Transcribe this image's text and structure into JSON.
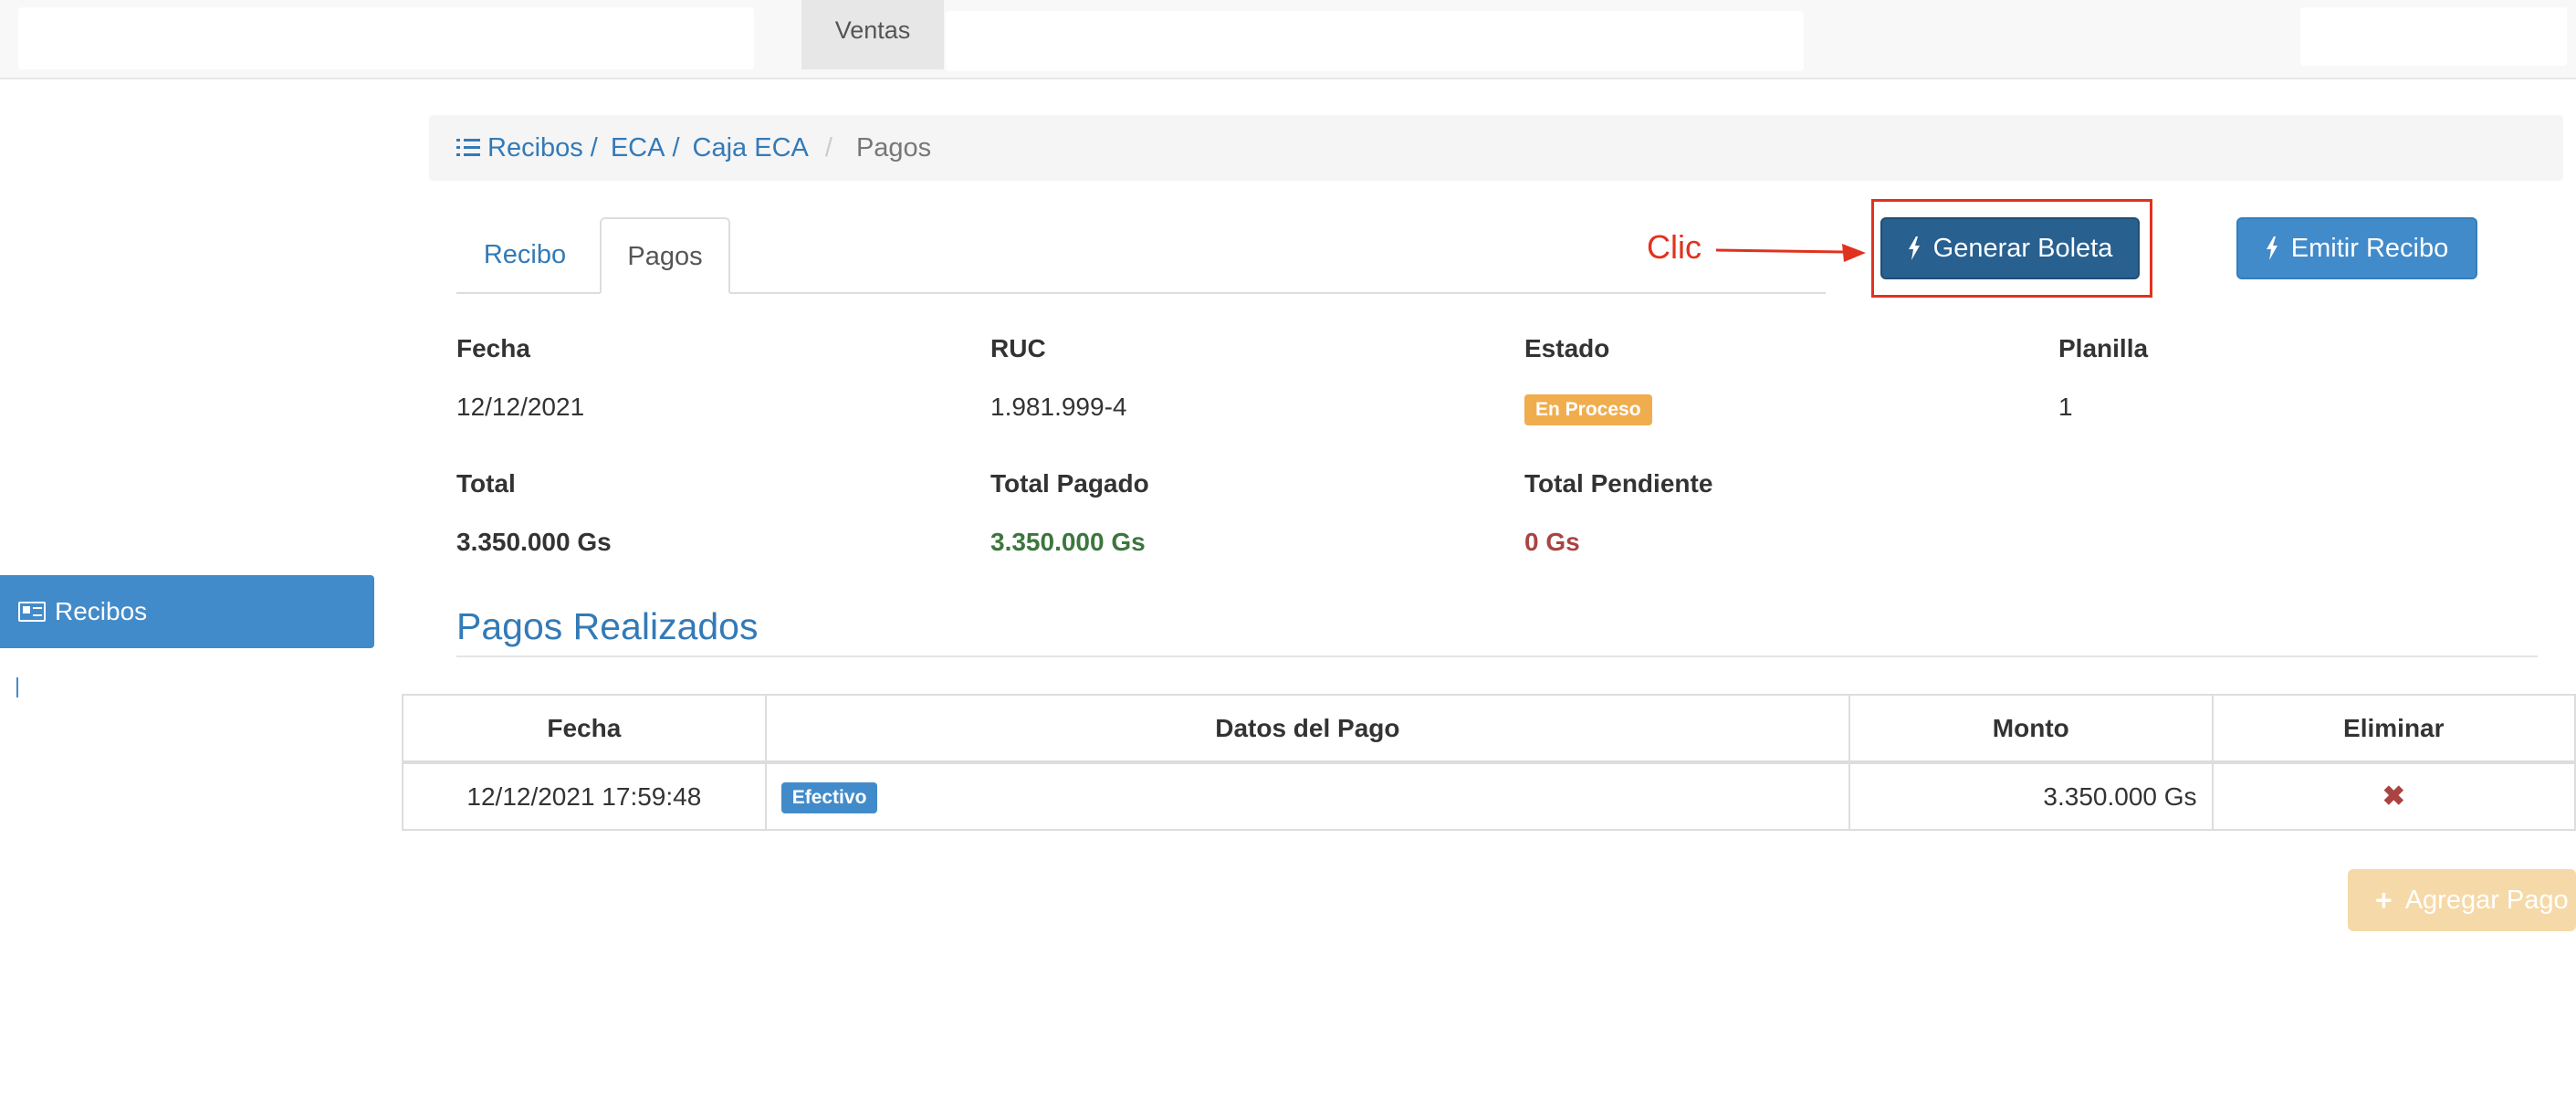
{
  "topbar": {
    "nav_item": "Ventas"
  },
  "sidebar": {
    "items": [
      {
        "label": "Recibos",
        "icon": "newspaper-icon"
      }
    ]
  },
  "breadcrumb": {
    "icon": "list-icon",
    "items": [
      "Recibos",
      "ECA",
      "Caja ECA"
    ],
    "separator": "/",
    "active": "Pagos"
  },
  "tabs": [
    {
      "label": "Recibo"
    },
    {
      "label": "Pagos",
      "active": true
    }
  ],
  "actions": {
    "generate_label": "Generar Boleta",
    "emit_label": "Emitir Recibo",
    "add_payment_label": "Agregar Pago",
    "annotation_label": "Clic",
    "icon": "bolt-icon"
  },
  "info": {
    "fecha_label": "Fecha",
    "fecha": "12/12/2021",
    "ruc_label": "RUC",
    "ruc": "1.981.999-4",
    "estado_label": "Estado",
    "estado": "En Proceso",
    "planilla_label": "Planilla",
    "planilla": "1",
    "total_label": "Total",
    "total": "3.350.000 Gs",
    "total_pagado_label": "Total Pagado",
    "total_pagado": "3.350.000 Gs",
    "total_pendiente_label": "Total Pendiente",
    "total_pendiente": "0 Gs"
  },
  "payments": {
    "title": "Pagos Realizados",
    "columns": [
      "Fecha",
      "Datos del Pago",
      "Monto",
      "Eliminar"
    ],
    "rows": [
      {
        "fecha": "12/12/2021 17:59:48",
        "tipo": "Efectivo",
        "monto": "3.350.000 Gs",
        "delete": "✖"
      }
    ]
  },
  "colors": {
    "primary": "#428bca",
    "primary_dark": "#286090",
    "warning": "#f0ad4e",
    "success_text": "#3c763d",
    "danger_text": "#a94442",
    "annotation": "#e0321f"
  }
}
